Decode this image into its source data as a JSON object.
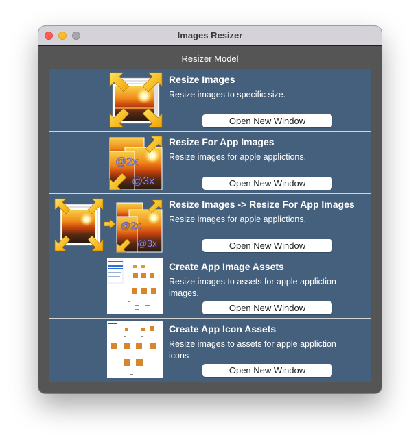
{
  "window": {
    "title": "Images Resizer",
    "section_title": "Resizer Model"
  },
  "rows": [
    {
      "title": "Resize Images",
      "description": "Resize images to specific size.",
      "button": "Open New Window",
      "thumbnail": "sunset-resize-icon"
    },
    {
      "title": "Resize For App Images",
      "description": "Resize images for apple applictions.",
      "button": "Open New Window",
      "thumbnail": "sunset-2x-3x-icon",
      "badges": [
        "@2x",
        "@3x"
      ]
    },
    {
      "title": "Resize Images -> Resize For App Images",
      "description": "Resize images for apple applictions.",
      "button": "Open New Window",
      "thumbnail": "combined-resize-icon",
      "badges": [
        "@2x",
        "@3x"
      ]
    },
    {
      "title": "Create App Image Assets",
      "description": "Resize images to assets for apple appliction images.",
      "button": "Open New Window",
      "thumbnail": "image-assets-screenshot"
    },
    {
      "title": "Create App Icon Assets",
      "description": "Resize images to assets for apple appliction icons",
      "button": "Open New Window",
      "thumbnail": "icon-assets-screenshot"
    }
  ],
  "colors": {
    "row_background": "#45607d",
    "window_background": "#555555",
    "titlebar": "#d5d2da"
  }
}
